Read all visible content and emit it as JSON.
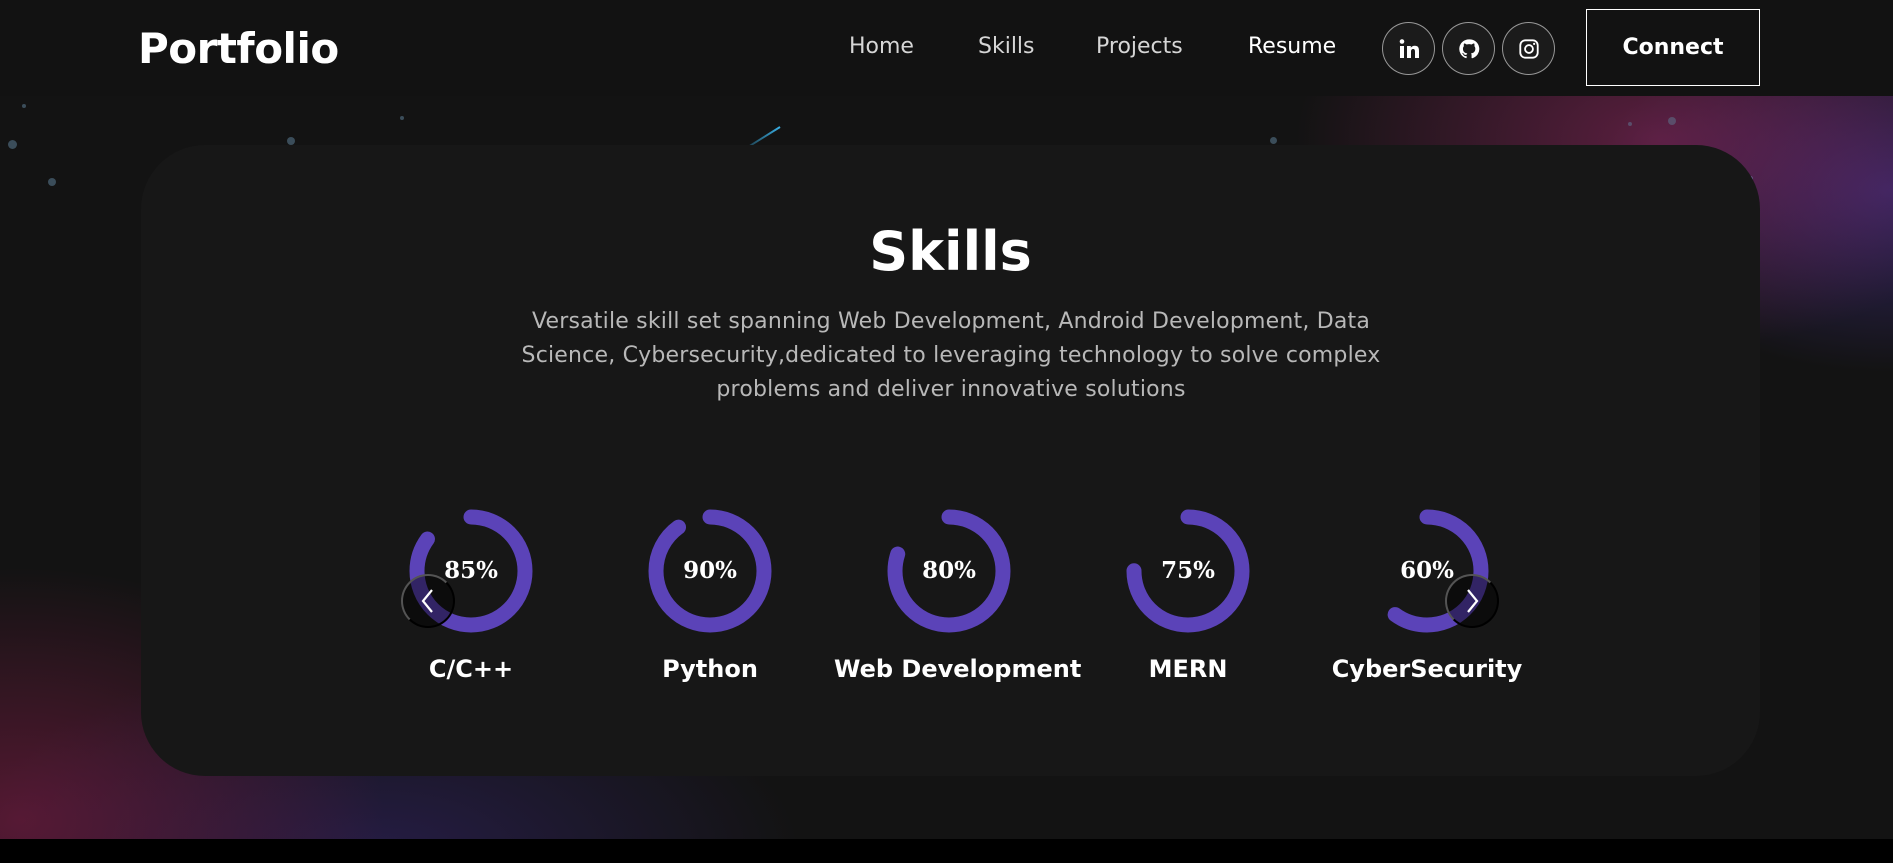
{
  "header": {
    "logo": "Portfolio",
    "nav": [
      {
        "label": "Home"
      },
      {
        "label": "Skills"
      },
      {
        "label": "Projects"
      },
      {
        "label": "Resume"
      }
    ],
    "social_icons": [
      "linkedin-icon",
      "github-icon",
      "instagram-icon"
    ],
    "connect_label": "Connect"
  },
  "skills": {
    "title": "Skills",
    "description": "Versatile skill set spanning Web Development, Android Development, Data Science, Cybersecurity,dedicated to leveraging technology to solve complex problems and deliver innovative solutions",
    "items": [
      {
        "name": "C/C++",
        "value": "85%",
        "percent": 85
      },
      {
        "name": "Python",
        "value": "90%",
        "percent": 90
      },
      {
        "name": "Web Development",
        "value": "80%",
        "percent": 80
      },
      {
        "name": "MERN",
        "value": "75%",
        "percent": 75
      },
      {
        "name": "CyberSecurity",
        "value": "60%",
        "percent": 60
      }
    ],
    "carousel_icons": [
      "chevron-left-icon",
      "chevron-right-icon"
    ]
  },
  "colors": {
    "accent": "#5b43b8",
    "background": "#121212",
    "card": "#171717"
  }
}
